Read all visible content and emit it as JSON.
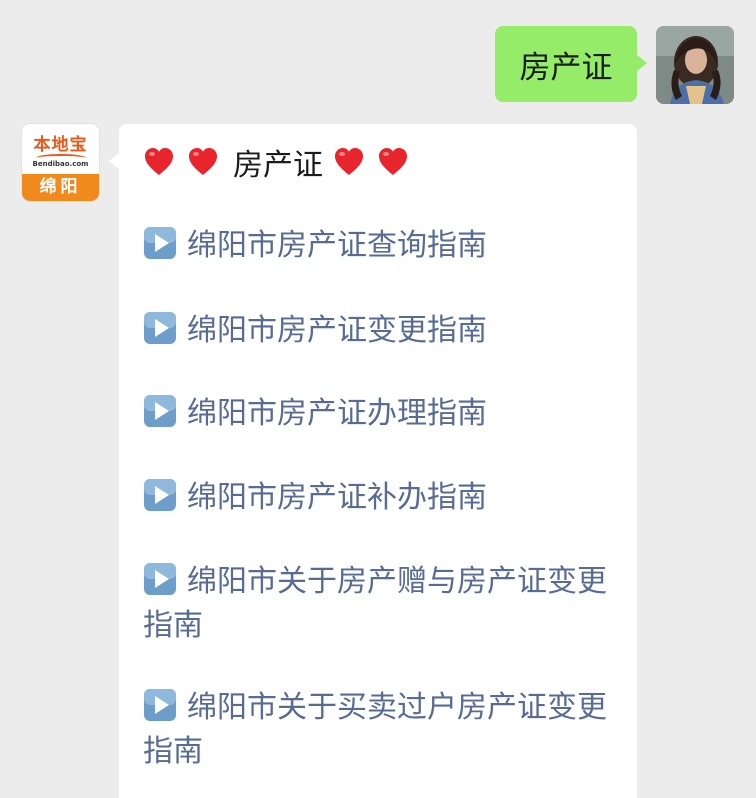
{
  "outgoing": {
    "text": "房产证"
  },
  "incoming": {
    "avatar": {
      "brand": "本地宝",
      "domain": "Bendibao.com",
      "city": "绵阳",
      "brand_color": "#e8591a",
      "city_bg": "#f08a1c"
    },
    "header": {
      "title": "房产证",
      "icon": "heart-icon",
      "icon_color": "#e8242c"
    },
    "links": [
      {
        "label": "绵阳市房产证查询指南"
      },
      {
        "label": "绵阳市房产证变更指南"
      },
      {
        "label": "绵阳市房产证办理指南"
      },
      {
        "label": "绵阳市房产证补办指南"
      },
      {
        "label": "绵阳市关于房产赠与房产证变更指南"
      },
      {
        "label": "绵阳市关于买卖过户房产证变更指南"
      }
    ],
    "link_icon": "play-button-icon",
    "link_color": "#576b95"
  },
  "colors": {
    "background": "#ececec",
    "bubble_out": "#95ec69",
    "bubble_in": "#ffffff"
  }
}
